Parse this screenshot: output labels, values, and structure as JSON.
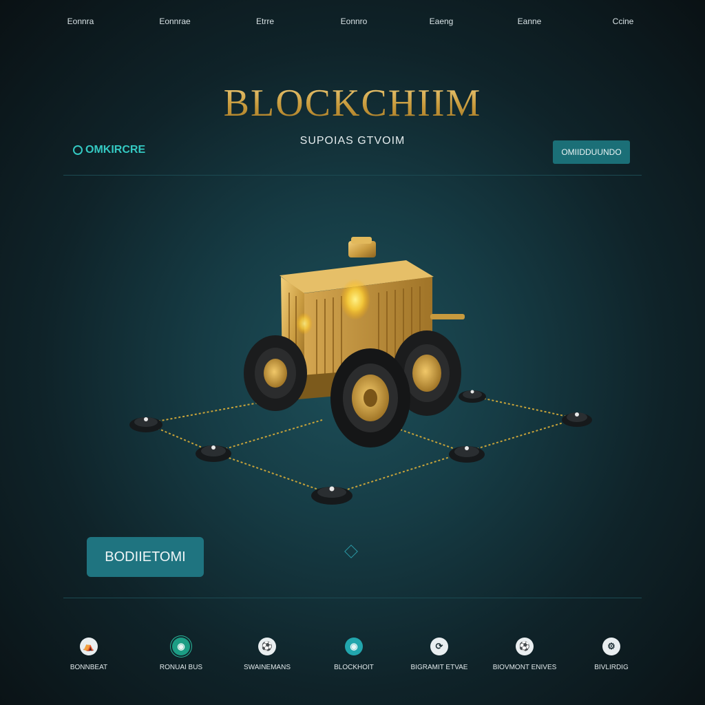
{
  "nav": {
    "items": [
      "Eonnra",
      "Eonnrae",
      "Etrre",
      "Eonnro",
      "Eaeng",
      "Eanne",
      "Ccine"
    ]
  },
  "header": {
    "title": "BLOCKCHIIM",
    "subtitle": "SUPOIAS GTVOIM",
    "brand_label": "OMKIRCRE",
    "top_button_label": "OMIIDDUUNDO"
  },
  "main": {
    "cta_label": "BODIIETOMI",
    "hero_icon": "mining-truck-network-illustration"
  },
  "footer": {
    "items": [
      {
        "label": "BONNBEAT",
        "icon": "running-figure-icon",
        "style": "light"
      },
      {
        "label": "RONUAI BUS",
        "icon": "globe-icon",
        "style": "green"
      },
      {
        "label": "SWAINEMANS",
        "icon": "soccer-ball-icon",
        "style": "light"
      },
      {
        "label": "BLOCKHOIT",
        "icon": "globe-icon",
        "style": "teal"
      },
      {
        "label": "BIGRAMIT ETVAE",
        "icon": "cycle-icon",
        "style": "light"
      },
      {
        "label": "BIOVMONT ENIVES",
        "icon": "soccer-ball-icon",
        "style": "light"
      },
      {
        "label": "BIVLIRDIG",
        "icon": "gear-icon",
        "style": "light"
      }
    ]
  },
  "colors": {
    "accent_teal": "#1f7480",
    "brand_cyan": "#34c9c2",
    "gold": "#c99a3d",
    "background_dark": "#0f2329"
  }
}
